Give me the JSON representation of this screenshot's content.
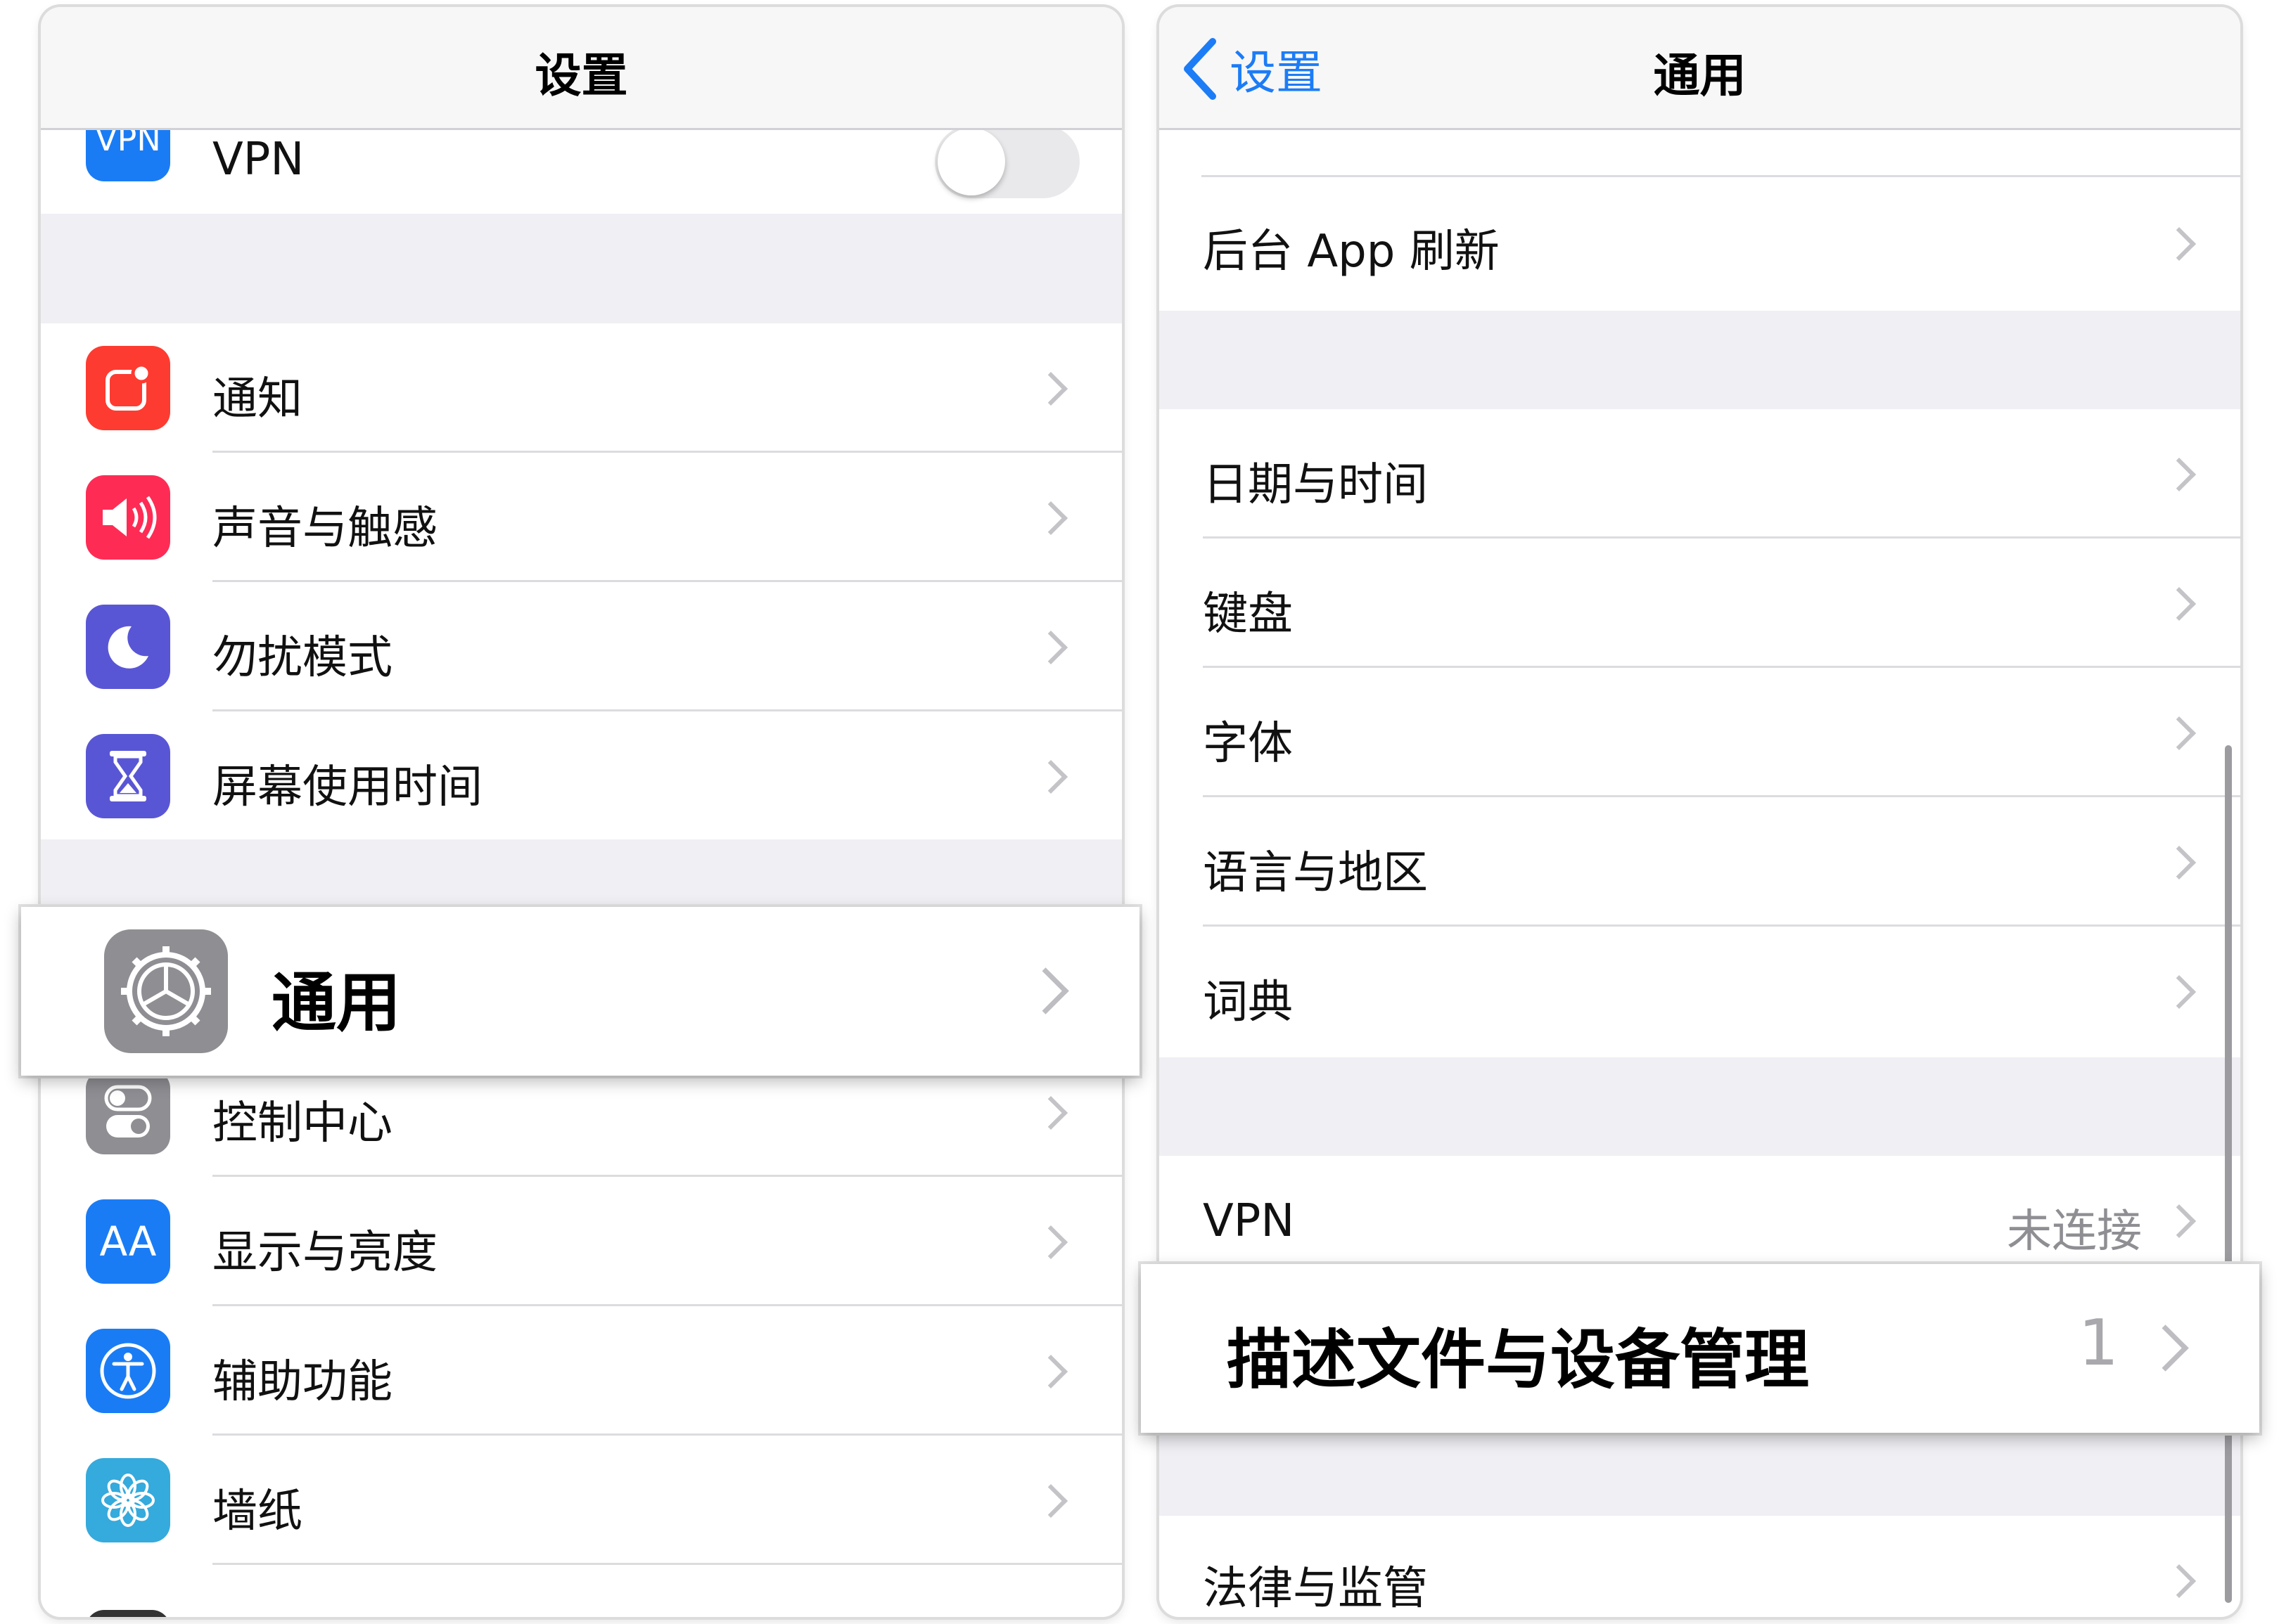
{
  "left": {
    "title": "设置",
    "vpn": {
      "icon_text": "VPN",
      "label": "VPN",
      "toggle_on": false
    },
    "items_a": [
      {
        "label": "通知",
        "icon": "notifications-icon",
        "color": "#fe3b30"
      },
      {
        "label": "声音与触感",
        "icon": "sounds-icon",
        "color": "#fe2c55"
      },
      {
        "label": "勿扰模式",
        "icon": "moon-icon",
        "color": "#5956d5"
      },
      {
        "label": "屏幕使用时间",
        "icon": "hourglass-icon",
        "color": "#5956d5"
      }
    ],
    "highlight": {
      "label": "通用",
      "icon": "gear-icon",
      "color": "#8e8e93"
    },
    "items_b": [
      {
        "label": "控制中心",
        "icon": "toggles-icon",
        "color": "#8e8e93"
      },
      {
        "label": "显示与亮度",
        "icon": "text-size-icon",
        "icon_text": "AA",
        "color": "#1a7cf5"
      },
      {
        "label": "辅助功能",
        "icon": "accessibility-icon",
        "color": "#1a7cf5"
      },
      {
        "label": "墙纸",
        "icon": "flower-icon",
        "color": "#35aadc"
      }
    ]
  },
  "right": {
    "back_label": "设置",
    "title": "通用",
    "group1": [
      {
        "label": "后台 App 刷新"
      }
    ],
    "group2": [
      {
        "label": "日期与时间"
      },
      {
        "label": "键盘"
      },
      {
        "label": "字体"
      },
      {
        "label": "语言与地区"
      },
      {
        "label": "词典"
      }
    ],
    "vpn": {
      "label": "VPN",
      "value": "未连接"
    },
    "highlight": {
      "label": "描述文件与设备管理",
      "value": "1"
    },
    "group4": [
      {
        "label": "法律与监管"
      }
    ]
  }
}
